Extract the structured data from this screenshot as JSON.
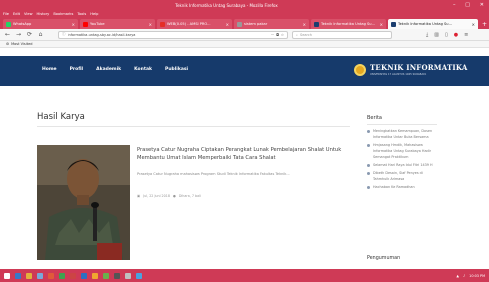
{
  "browser": {
    "window_title": "Teknik Informatika Untag Surabaya - Mozilla Firefox",
    "menu": [
      "File",
      "Edit",
      "View",
      "History",
      "Bookmarks",
      "Tools",
      "Help"
    ],
    "tabs": [
      {
        "label": "WhatsApp",
        "icon": "whatsapp-icon",
        "color": "#25d366",
        "active": false
      },
      {
        "label": "YouTube",
        "icon": "youtube-icon",
        "color": "#ff0000",
        "active": false
      },
      {
        "label": "WEB(0.05) - AMSI PRO...",
        "icon": "web-icon",
        "color": "#e52d27",
        "active": false
      },
      {
        "label": "sistem pakar",
        "icon": "page-icon",
        "color": "#999999",
        "active": false
      },
      {
        "label": "Teknik Informatika Untag Su...",
        "icon": "site-icon",
        "color": "#1b3e6f",
        "active": false
      },
      {
        "label": "Teknik Informatika Untag Su...",
        "icon": "site-icon",
        "color": "#1b3e6f",
        "active": true
      }
    ],
    "url": "informatika.untag-sby.ac.id/hasil-karya",
    "search_placeholder": "Search",
    "bookmark": "Most Visited"
  },
  "site": {
    "nav": [
      "Home",
      "Profil",
      "Akademik",
      "Kontak",
      "Publikasi"
    ],
    "brand_title": "TEKNIK INFORMATIKA",
    "brand_subtitle": "UNIVERSITAS 17 AGUSTUS 1945 SURABAYA"
  },
  "main": {
    "page_title": "Hasil Karya",
    "post": {
      "title": "Prasetya Catur Nugraha Ciptakan Perangkat Lunak Pembelajaran Shalat Untuk Membantu Umat Islam Memperbaiki Tata Cara Shalat",
      "excerpt": "Prasetya Catur Nugraha mahasiswa Program Studi Teknik Informatika Fakultas Teknik...",
      "date": "Jul, 22 Juni 2018",
      "author": "Dihara, 7 bali"
    }
  },
  "sidebar": {
    "title": "Berita",
    "items": [
      "Meningkatkan Kemampuan, Dosen Informatika Untar Buka Bersama",
      "Hmjasang Hmdik, Mahasiswa Informatika Untag Surabaya Hadir Semangat Praktikum",
      "Selamat Hari Raya Idul Fitri 1439 H",
      "Dibeth Desain, Siaf Penyes di Tahmhulk Arimasa",
      "Hachaban Ke Ramadhan"
    ],
    "title2": "Pengumuman"
  },
  "taskbar": {
    "tray_text": "10:03 PM",
    "colors": [
      "#3778c8",
      "#e2b13c",
      "#7aa8d8",
      "#e05a3a",
      "#3fa150",
      "#c44",
      "#2c70c0",
      "#f0a830",
      "#6ab04c",
      "#555555",
      "#c0c0c0",
      "#4aa3df"
    ]
  },
  "colors": {
    "browser_chrome": "#cf3a56",
    "site_nav": "#163a6b",
    "brand_gold": "#e4a821"
  }
}
